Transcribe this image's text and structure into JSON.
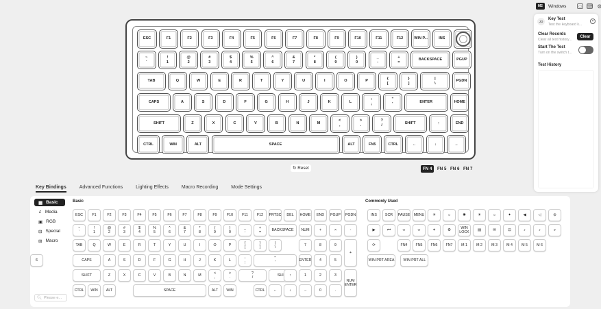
{
  "topbar": {
    "mode": "M2",
    "os": "Windows"
  },
  "keyboard": {
    "rows": [
      [
        [
          "ESC",
          ""
        ],
        [
          "F1",
          ""
        ],
        [
          "F2",
          ""
        ],
        [
          "F3",
          ""
        ],
        [
          "F4",
          ""
        ],
        [
          "F5",
          ""
        ],
        [
          "F6",
          ""
        ],
        [
          "F7",
          ""
        ],
        [
          "F8",
          ""
        ],
        [
          "F9",
          ""
        ],
        [
          "F10",
          ""
        ],
        [
          "F11",
          ""
        ],
        [
          "F12",
          ""
        ],
        [
          "WIN P...",
          ""
        ],
        [
          "INS",
          ""
        ]
      ],
      [
        [
          "~",
          "`"
        ],
        [
          "!",
          "1"
        ],
        [
          "@",
          "2"
        ],
        [
          "#",
          "3"
        ],
        [
          "$",
          "4"
        ],
        [
          "%",
          "5"
        ],
        [
          "^",
          "6"
        ],
        [
          "&",
          "7"
        ],
        [
          "*",
          "8"
        ],
        [
          "(",
          "9"
        ],
        [
          ")",
          "0"
        ],
        [
          "_",
          "-"
        ],
        [
          "+",
          "="
        ],
        [
          "BACKSPACE",
          ""
        ],
        [
          "PGUP",
          ""
        ]
      ],
      [
        [
          "TAB",
          ""
        ],
        [
          "Q",
          ""
        ],
        [
          "W",
          ""
        ],
        [
          "E",
          ""
        ],
        [
          "R",
          ""
        ],
        [
          "T",
          ""
        ],
        [
          "Y",
          ""
        ],
        [
          "U",
          ""
        ],
        [
          "I",
          ""
        ],
        [
          "O",
          ""
        ],
        [
          "P",
          ""
        ],
        [
          "{",
          "["
        ],
        [
          "}",
          "]"
        ],
        [
          "|",
          "\\"
        ],
        [
          "PGDN",
          ""
        ]
      ],
      [
        [
          "CAPS",
          ""
        ],
        [
          "A",
          ""
        ],
        [
          "S",
          ""
        ],
        [
          "D",
          ""
        ],
        [
          "F",
          ""
        ],
        [
          "G",
          ""
        ],
        [
          "H",
          ""
        ],
        [
          "J",
          ""
        ],
        [
          "K",
          ""
        ],
        [
          "L",
          ""
        ],
        [
          ":",
          ";"
        ],
        [
          "\"",
          "'"
        ],
        [
          "ENTER",
          ""
        ],
        [
          "HOME",
          ""
        ]
      ],
      [
        [
          "SHIFT",
          ""
        ],
        [
          "Z",
          ""
        ],
        [
          "X",
          ""
        ],
        [
          "C",
          ""
        ],
        [
          "V",
          ""
        ],
        [
          "B",
          ""
        ],
        [
          "N",
          ""
        ],
        [
          "M",
          ""
        ],
        [
          "<",
          ","
        ],
        [
          ">",
          "."
        ],
        [
          "?",
          "/"
        ],
        [
          "SHIFT",
          ""
        ],
        [
          "↑",
          ""
        ],
        [
          "END",
          ""
        ]
      ],
      [
        [
          "CTRL",
          ""
        ],
        [
          "WIN",
          ""
        ],
        [
          "ALT",
          ""
        ],
        [
          "SPACE",
          ""
        ],
        [
          "ALT",
          ""
        ],
        [
          "FN5",
          ""
        ],
        [
          "CTRL",
          ""
        ],
        [
          "←",
          ""
        ],
        [
          "↓",
          ""
        ],
        [
          "→",
          ""
        ]
      ]
    ]
  },
  "reset_label": "Reset",
  "fn_layers": [
    "FN 4",
    "FN 5",
    "FN 6",
    "FN 7"
  ],
  "panel": {
    "key_test_title": "Key Test",
    "key_test_desc": "Test the keyboard k...",
    "clear_title": "Clear Records",
    "clear_desc": "Clear all test history...",
    "clear_button": "Clear",
    "start_title": "Start The Test",
    "start_desc": "Turn on the switch t...",
    "history_title": "Test History"
  },
  "tabs": [
    "Key Bindings",
    "Advanced Functions",
    "Lighting Effects",
    "Macro Recording",
    "Mode Settings"
  ],
  "sidebar": [
    "Basic",
    "Media",
    "RGB",
    "Special",
    "Macro"
  ],
  "search_placeholder": "Please e...",
  "basic_title": "Basic",
  "common_title": "Commonly Used",
  "basic_keys": [
    [
      "ESC",
      "F1",
      "F2",
      "F3",
      "F4",
      "F5",
      "F6",
      "F7",
      "F8",
      "F9",
      "F10",
      "F11",
      "F12",
      "PRTSC",
      "DEL",
      "HOME",
      "END",
      "PGUP",
      "PGDN"
    ],
    [
      [
        "~",
        "`"
      ],
      [
        "!",
        "1"
      ],
      [
        "@",
        "2"
      ],
      [
        "#",
        "3"
      ],
      [
        "$",
        "4"
      ],
      [
        "%",
        "5"
      ],
      [
        "^",
        "6"
      ],
      [
        "&",
        "7"
      ],
      [
        "*",
        "8"
      ],
      [
        "(",
        "9"
      ],
      [
        ")",
        "0"
      ],
      [
        "_",
        "-"
      ],
      [
        "+",
        "="
      ],
      "BACKSPACE",
      "NUM",
      "+",
      "×",
      "-"
    ],
    [
      "TAB",
      "Q",
      "W",
      "E",
      "R",
      "T",
      "Y",
      "U",
      "I",
      "O",
      "P",
      [
        "{",
        "["
      ],
      [
        "}",
        "]"
      ],
      [
        "|",
        "\\"
      ],
      "7",
      "8",
      "9"
    ],
    [
      "CAPS",
      "A",
      "S",
      "D",
      "F",
      "G",
      "H",
      "J",
      "K",
      "L",
      [
        ":",
        ";"
      ],
      [
        "\"",
        "'"
      ],
      "ENTER",
      "4",
      "5",
      "6"
    ],
    [
      "SHIFT",
      "Z",
      "X",
      "C",
      "V",
      "B",
      "N",
      "M",
      [
        "<",
        ","
      ],
      [
        ">",
        "."
      ],
      [
        "?",
        "/"
      ],
      "SHIFT",
      "↑",
      "1",
      "2",
      "3"
    ],
    [
      "CTRL",
      "WIN",
      "ALT",
      "SPACE",
      "ALT",
      "WIN",
      "CTRL",
      "←",
      "↓",
      "→",
      "0",
      "."
    ]
  ],
  "common_keys": [
    "INS",
    "SCR",
    "PAUSE",
    "MENU",
    "FN4",
    "FN5",
    "FN6",
    "FN7",
    "M 1",
    "M 2",
    "M 3",
    "M 4",
    "M 5",
    "M 6",
    "WIN PRT AREA",
    "WIN PRT ALL",
    "WIN LOCK"
  ]
}
